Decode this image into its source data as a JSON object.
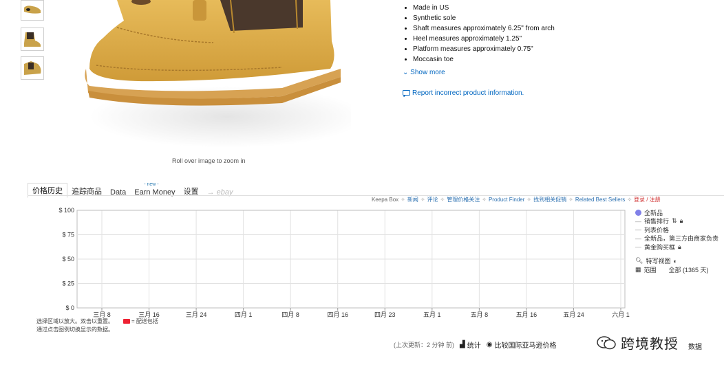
{
  "product": {
    "zoom_hint": "Roll over image to zoom in",
    "bullets": [
      "Made in US",
      "Synthetic sole",
      "Shaft measures approximately 6.25\" from arch",
      "Heel measures approximately 1.25\"",
      "Platform measures approximately 0.75\"",
      "Moccasin toe"
    ],
    "show_more": "Show more",
    "report": "Report incorrect product information."
  },
  "keepa": {
    "tabs": [
      {
        "label": "价格历史"
      },
      {
        "label": "追踪商品"
      },
      {
        "label": "Data"
      },
      {
        "label": "Earn Money",
        "badge": "- new -"
      },
      {
        "label": "设置"
      },
      {
        "label": "→ ebay"
      }
    ],
    "links": {
      "keepa_box": "Keepa Box",
      "news": "新闻",
      "reviews": "评论",
      "manage": "管理价格关注",
      "finder": "Product Finder",
      "deals": "找到相关促销",
      "related": "Related Best Sellers",
      "login": "登录 / 注册"
    },
    "legend": {
      "new": "全新品",
      "sales_rank": "销售排行",
      "list_price": "列表价格",
      "new_3p": "全新品，第三方由商家负责",
      "buy_box": "黄金购买框",
      "compact_view": "特写视图",
      "range_label": "范围",
      "range_value": "全部 (1365 天)"
    },
    "hint_line1": "选择区域以放大。双击以重置。",
    "hint_free_ship": "= 配送包括",
    "hint_line2": "通过点击图例切换显示的数据。",
    "last_update": "(上次更新：2 分钟 前)",
    "stats": "统计",
    "compare": "比较国际亚马逊价格",
    "watermark": "跨境教授",
    "tail": "数据"
  },
  "chart_data": {
    "type": "line",
    "title": "",
    "xlabel": "",
    "ylabel": "",
    "y_ticks": [
      "$ 0",
      "$ 25",
      "$ 50",
      "$ 75",
      "$ 100"
    ],
    "ylim": [
      0,
      100
    ],
    "x_ticks": [
      "三月 8",
      "三月 16",
      "三月 24",
      "四月 1",
      "四月 8",
      "四月 16",
      "四月 23",
      "五月 1",
      "五月 8",
      "五月 16",
      "五月 24",
      "六月 1"
    ],
    "series": [],
    "grid": true
  },
  "colors": {
    "link": "#0066c0",
    "new_series": "#8080e8",
    "login": "#d03030"
  }
}
